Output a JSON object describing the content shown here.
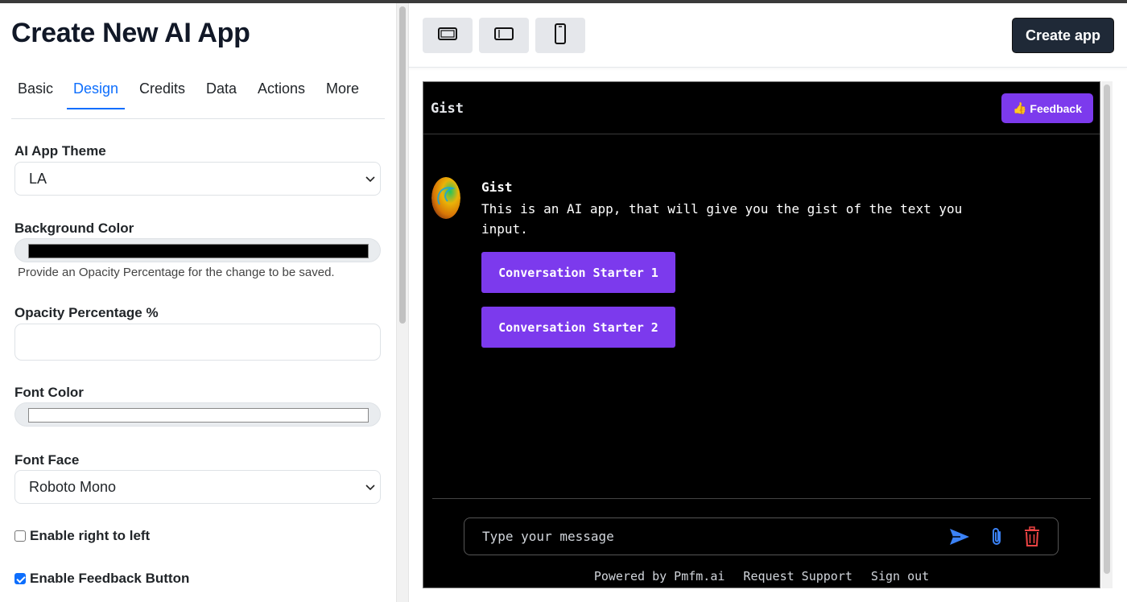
{
  "page": {
    "title": "Create New AI App"
  },
  "tabs": [
    {
      "label": "Basic"
    },
    {
      "label": "Design"
    },
    {
      "label": "Credits"
    },
    {
      "label": "Data"
    },
    {
      "label": "Actions"
    },
    {
      "label": "More"
    }
  ],
  "active_tab": "Design",
  "form": {
    "theme_label": "AI App Theme",
    "theme_value": "LA",
    "bg_color_label": "Background Color",
    "bg_color_value": "#000000",
    "bg_hint": "Provide an Opacity Percentage for the change to be saved.",
    "opacity_label": "Opacity Percentage %",
    "opacity_value": "",
    "font_color_label": "Font Color",
    "font_color_value": "#ffffff",
    "font_face_label": "Font Face",
    "font_face_value": "Roboto Mono",
    "rtl_label": "Enable right to left",
    "rtl_checked": false,
    "feedback_label": "Enable Feedback Button",
    "feedback_checked": true
  },
  "toolbar": {
    "device_icons": [
      "laptop-icon",
      "tablet-icon",
      "phone-icon"
    ],
    "create_label": "Create app"
  },
  "preview": {
    "app_title": "Gist",
    "feedback_label": "Feedback",
    "feedback_emoji": "👍",
    "message_name": "Gist",
    "message_text": "This is an AI app, that will give you the gist of the text you input.",
    "starters": [
      "Conversation Starter 1",
      "Conversation Starter 2"
    ],
    "input_placeholder": "Type your message",
    "footer": [
      "Powered by Pmfm.ai",
      "Request Support",
      "Sign out"
    ]
  },
  "colors": {
    "accent_purple": "#7c3aed",
    "tab_blue": "#0d6efd",
    "dark_button": "#1f2937",
    "send_icon": "#3b82f6",
    "trash_icon": "#ef4444"
  }
}
